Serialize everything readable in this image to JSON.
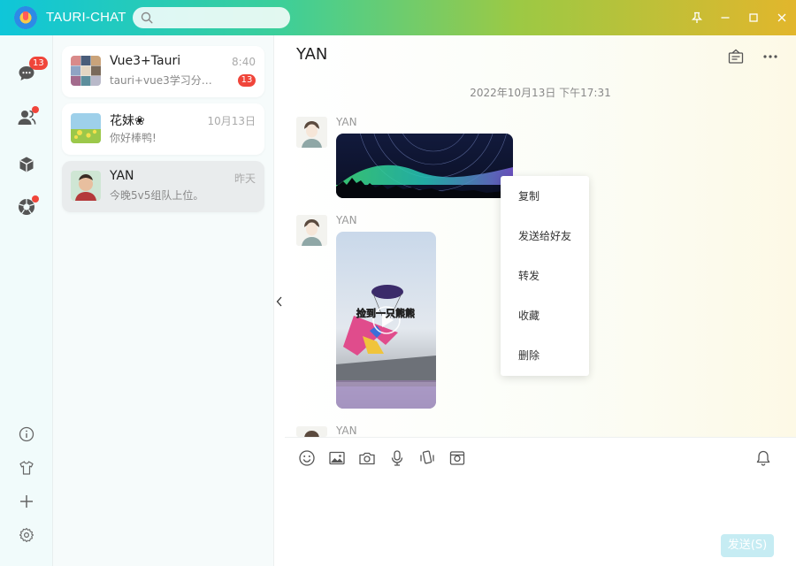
{
  "app": {
    "title": "TAURI-CHAT"
  },
  "search": {
    "placeholder": ""
  },
  "window_controls": {
    "icons": [
      "pin-icon",
      "minimize-icon",
      "maximize-icon",
      "close-icon"
    ]
  },
  "nav": {
    "chat_badge": "13",
    "items": [
      {
        "icon": "chat-bubble-icon",
        "badge": "13"
      },
      {
        "icon": "contacts-icon",
        "dot": true
      },
      {
        "icon": "cube-icon"
      },
      {
        "icon": "aperture-icon",
        "dot": true
      }
    ],
    "bottom_icons": [
      "info-icon",
      "tshirt-icon",
      "plus-icon",
      "settings-icon"
    ]
  },
  "conversations": [
    {
      "name": "Vue3+Tauri",
      "time": "8:40",
      "preview": "tauri+vue3学习分享…",
      "unread": "13"
    },
    {
      "name": "花妹❀",
      "time": "10月13日",
      "preview": "你好棒鸭!"
    },
    {
      "name": "YAN",
      "time": "昨天",
      "preview": "今晚5v5组队上位。",
      "active": true
    }
  ],
  "chat": {
    "title": "YAN",
    "date_separator": "2022年10月13日 下午17:31",
    "messages": [
      {
        "sender": "YAN",
        "type": "image",
        "content": "aurora-night-sky-image"
      },
      {
        "sender": "YAN",
        "type": "video",
        "caption": "捡到一只熊熊"
      },
      {
        "sender": "YAN",
        "type": "partial"
      }
    ]
  },
  "context_menu": {
    "items": [
      "复制",
      "发送给好友",
      "转发",
      "收藏",
      "删除"
    ]
  },
  "composer": {
    "tools": [
      "emoji-icon",
      "image-icon",
      "camera-icon",
      "microphone-icon",
      "shake-icon",
      "screenshot-icon"
    ],
    "bell_icon": "bell-icon",
    "send_label": "发送(S)"
  },
  "colors": {
    "titlebar_gradient": [
      "#0fc6d9",
      "#3ccf9a",
      "#9cc944",
      "#e2b62c"
    ],
    "badge": "#f0453a",
    "send_button": "#c6ecf3"
  }
}
